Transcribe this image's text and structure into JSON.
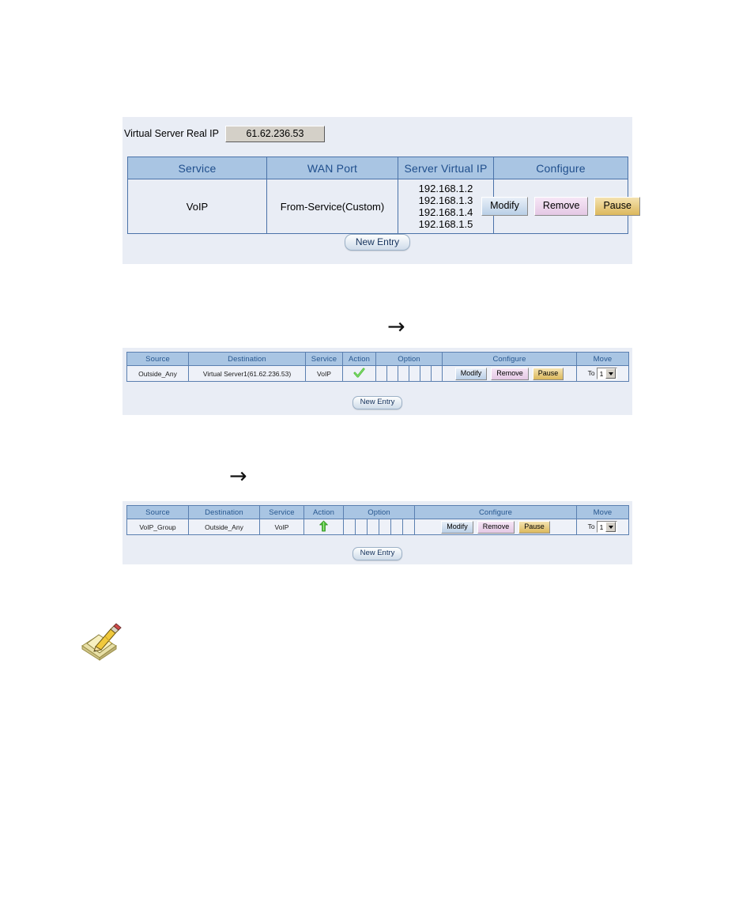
{
  "virtual_server": {
    "real_ip_label": "Virtual Server Real IP",
    "real_ip_value": "61.62.236.53",
    "headers": [
      "Service",
      "WAN Port",
      "Server Virtual IP",
      "Configure"
    ],
    "row": {
      "service": "VoIP",
      "wan_port": "From-Service(Custom)",
      "server_virtual_ips": [
        "192.168.1.2",
        "192.168.1.3",
        "192.168.1.4",
        "192.168.1.5"
      ],
      "buttons": [
        "Modify",
        "Remove",
        "Pause"
      ]
    },
    "new_entry_label": "New Entry"
  },
  "arrows": {
    "incoming": "→",
    "outgoing": "→"
  },
  "policy_incoming": {
    "headers": [
      "Source",
      "Destination",
      "Service",
      "Action",
      "Option",
      "Configure",
      "Move"
    ],
    "row": {
      "source": "Outside_Any",
      "destination": "Virtual Server1(61.62.236.53)",
      "service": "VoIP",
      "action_icon": "green-check-icon",
      "option_cells": [
        "",
        "",
        "",
        "",
        "",
        ""
      ],
      "buttons": [
        "Modify",
        "Remove",
        "Pause"
      ],
      "move_prefix": "To",
      "move_value": "1"
    },
    "new_entry_label": "New Entry"
  },
  "policy_outgoing": {
    "headers": [
      "Source",
      "Destination",
      "Service",
      "Action",
      "Option",
      "Configure",
      "Move"
    ],
    "row": {
      "source": "VoIP_Group",
      "destination": "Outside_Any",
      "service": "VoIP",
      "action_icon": "green-arrow-icon",
      "option_cells": [
        "",
        "",
        "",
        "",
        "",
        ""
      ],
      "buttons": [
        "Modify",
        "Remove",
        "Pause"
      ],
      "move_prefix": "To",
      "move_value": "1"
    },
    "new_entry_label": "New Entry"
  },
  "note": {
    "icon": "notepad-pencil-icon"
  },
  "colors": {
    "panel_bg": "#e9edf5",
    "header_bg": "#a9c5e3",
    "header_text": "#1f4e8c",
    "border": "#4a72a8",
    "modify_btn": "#b9cfe6",
    "remove_btn": "#e4c8e4",
    "pause_btn": "#dcb85c",
    "action_green": "#4fbf3a"
  }
}
